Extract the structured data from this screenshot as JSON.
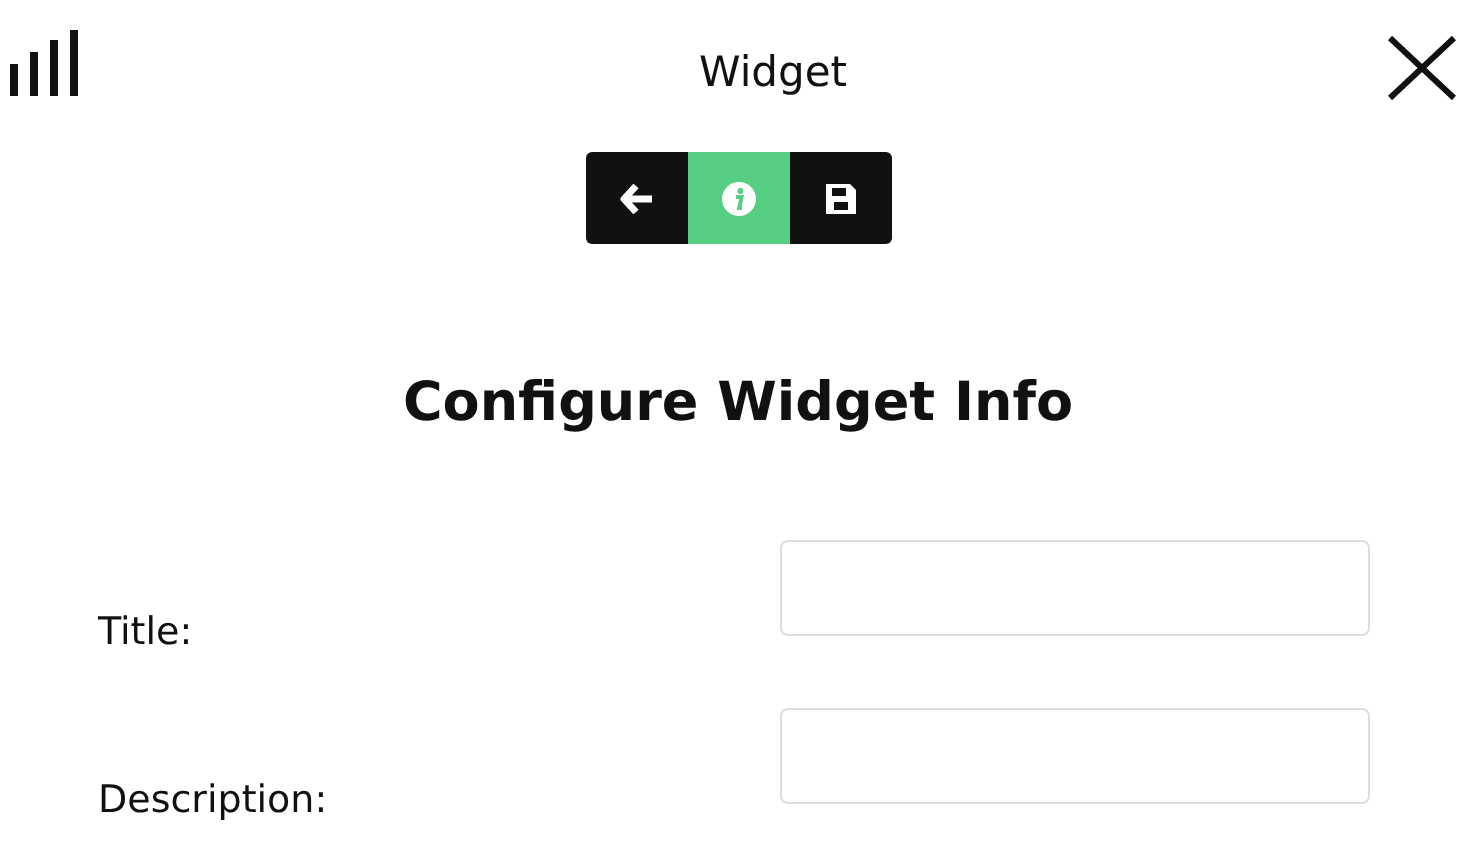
{
  "header": {
    "title": "Widget"
  },
  "toolbar": [
    {
      "kind": "back",
      "selected": false
    },
    {
      "kind": "info",
      "selected": true
    },
    {
      "kind": "save",
      "selected": false
    }
  ],
  "heading": "Configure Widget Info",
  "fields": [
    {
      "label": "Title:"
    },
    {
      "label": "Description:"
    }
  ]
}
